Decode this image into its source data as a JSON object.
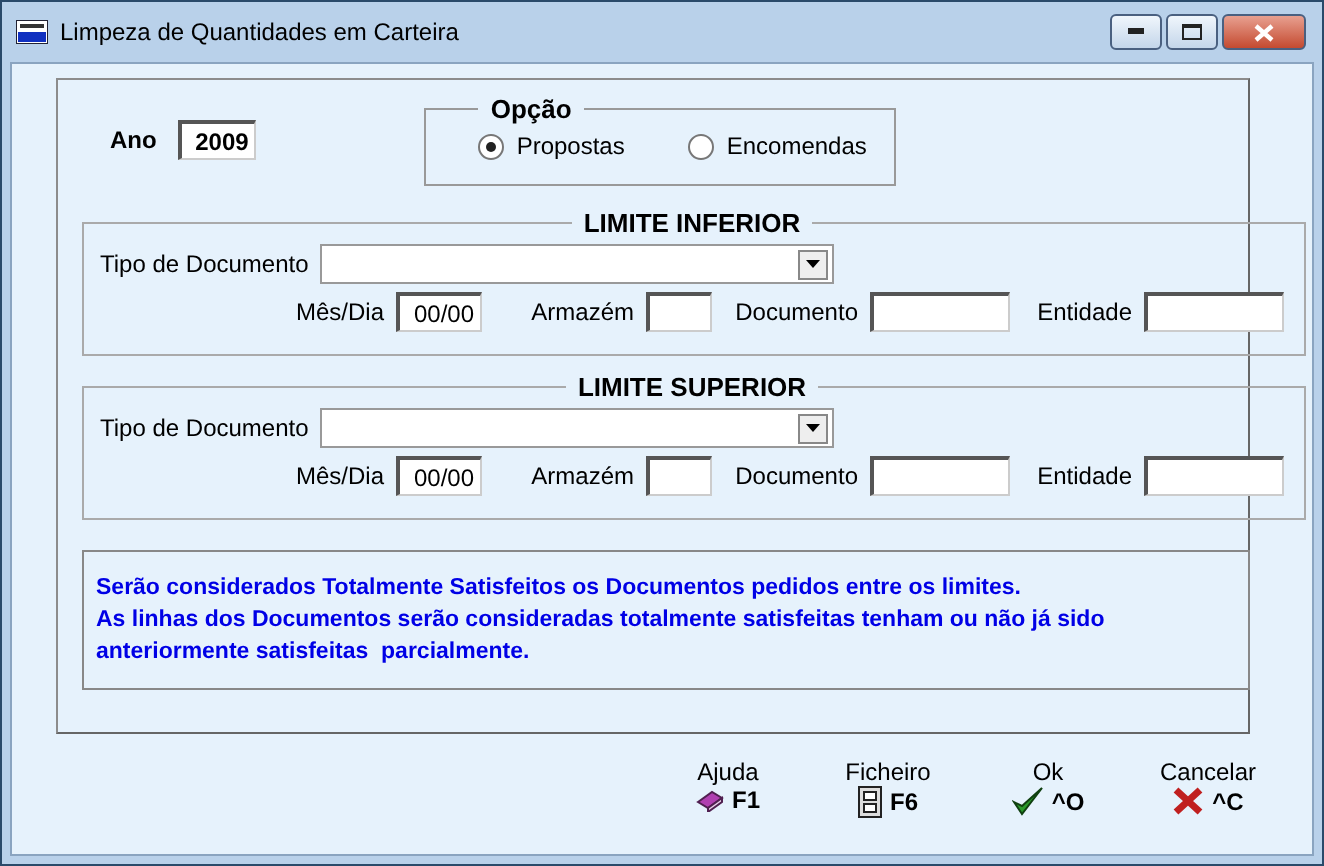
{
  "window": {
    "title": "Limpeza de Quantidades em Carteira"
  },
  "ano": {
    "label": "Ano",
    "value": "2009"
  },
  "opcao": {
    "title": "Opção",
    "options": [
      {
        "label": "Propostas",
        "selected": true
      },
      {
        "label": "Encomendas",
        "selected": false
      }
    ]
  },
  "limits": [
    {
      "title": "LIMITE INFERIOR",
      "tipo_label": "Tipo de Documento",
      "fields": [
        {
          "label": "Mês/Dia",
          "value": "00/00",
          "kind": "date"
        },
        {
          "label": "Armazém",
          "kind": "short"
        },
        {
          "label": "Documento",
          "kind": "wide"
        },
        {
          "label": "Entidade",
          "kind": "wide"
        }
      ]
    },
    {
      "title": "LIMITE SUPERIOR",
      "tipo_label": "Tipo de Documento",
      "fields": [
        {
          "label": "Mês/Dia",
          "value": "00/00",
          "kind": "date"
        },
        {
          "label": "Armazém",
          "kind": "short"
        },
        {
          "label": "Documento",
          "kind": "wide"
        },
        {
          "label": "Entidade",
          "kind": "wide"
        }
      ]
    }
  ],
  "message": [
    "Serão considerados Totalmente Satisfeitos os Documentos pedidos entre os limites.",
    "As linhas dos Documentos serão consideradas totalmente satisfeitas tenham ou não já sido anteriormente satisfeitas  parcialmente."
  ],
  "buttons": [
    {
      "label": "Ajuda",
      "key": "F1",
      "kind": "help"
    },
    {
      "label": "Ficheiro",
      "key": "F6",
      "kind": "file"
    },
    {
      "label": "Ok",
      "key": "^O",
      "kind": "ok"
    },
    {
      "label": "Cancelar",
      "key": "^C",
      "kind": "cancel"
    }
  ]
}
